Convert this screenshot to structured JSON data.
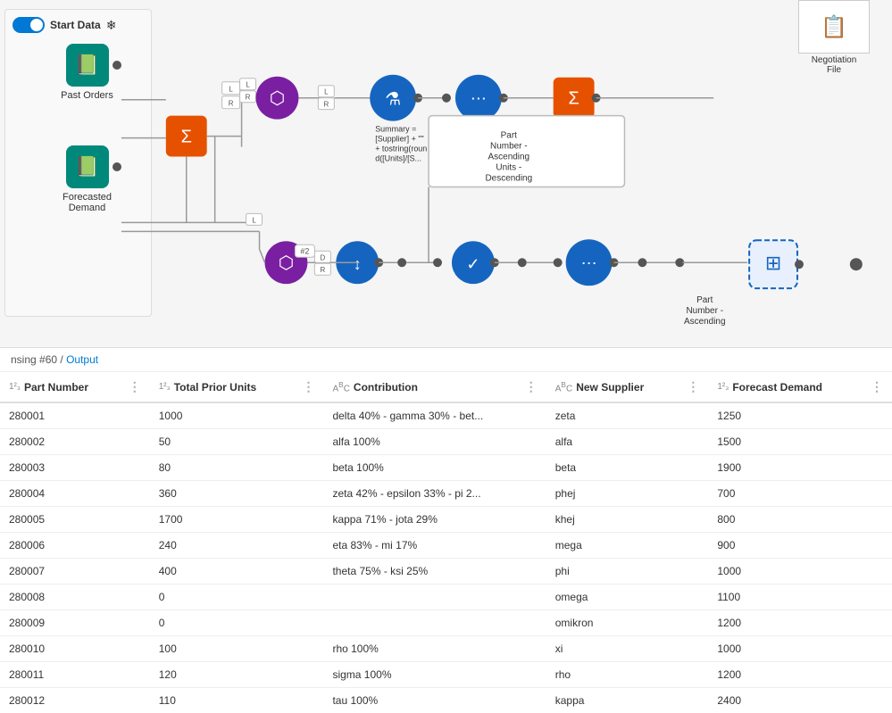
{
  "canvas": {
    "title": "Start Data",
    "snowflake_label": "❄",
    "nodes": {
      "past_orders": {
        "label": "Past Orders"
      },
      "forecasted_demand": {
        "label": "Forecasted\nDemand"
      },
      "summary_formula": {
        "label": "Summary =\n[Supplier] + \"\"\n+ tostring(roun\nd([Units]/[S..."
      },
      "part_number_sort": {
        "label": "Part\nNumber -\nAscending\nUnits -\nDescending"
      },
      "part_number_asc": {
        "label": "Part\nNumber -\nAscending"
      },
      "neg_file": {
        "label": "Negotiation\nFile"
      }
    }
  },
  "breadcrumb": {
    "prefix": "nsing #60",
    "separator": " / ",
    "link": "Output"
  },
  "table": {
    "columns": [
      {
        "type": "123",
        "name": "Part Number",
        "id": "part_number"
      },
      {
        "type": "123",
        "name": "Total Prior Units",
        "id": "total_prior_units"
      },
      {
        "type": "ABC",
        "name": "Contribution",
        "id": "contribution"
      },
      {
        "type": "ABC",
        "name": "New Supplier",
        "id": "new_supplier"
      },
      {
        "type": "123",
        "name": "Forecast Demand",
        "id": "forecast_demand"
      }
    ],
    "rows": [
      {
        "part_number": "280001",
        "total_prior_units": "1000",
        "contribution": "delta 40% - gamma 30% - bet...",
        "new_supplier": "zeta",
        "forecast_demand": "1250"
      },
      {
        "part_number": "280002",
        "total_prior_units": "50",
        "contribution": "alfa 100%",
        "new_supplier": "alfa",
        "forecast_demand": "1500"
      },
      {
        "part_number": "280003",
        "total_prior_units": "80",
        "contribution": "beta 100%",
        "new_supplier": "beta",
        "forecast_demand": "1900"
      },
      {
        "part_number": "280004",
        "total_prior_units": "360",
        "contribution": "zeta 42% - epsilon 33% - pi 2...",
        "new_supplier": "phej",
        "forecast_demand": "700"
      },
      {
        "part_number": "280005",
        "total_prior_units": "1700",
        "contribution": "kappa 71% - jota 29%",
        "new_supplier": "khej",
        "forecast_demand": "800"
      },
      {
        "part_number": "280006",
        "total_prior_units": "240",
        "contribution": "eta 83% - mi 17%",
        "new_supplier": "mega",
        "forecast_demand": "900"
      },
      {
        "part_number": "280007",
        "total_prior_units": "400",
        "contribution": "theta 75% - ksi 25%",
        "new_supplier": "phi",
        "forecast_demand": "1000"
      },
      {
        "part_number": "280008",
        "total_prior_units": "0",
        "contribution": "",
        "new_supplier": "omega",
        "forecast_demand": "1100"
      },
      {
        "part_number": "280009",
        "total_prior_units": "0",
        "contribution": "",
        "new_supplier": "omikron",
        "forecast_demand": "1200"
      },
      {
        "part_number": "280010",
        "total_prior_units": "100",
        "contribution": "rho 100%",
        "new_supplier": "xi",
        "forecast_demand": "1000"
      },
      {
        "part_number": "280011",
        "total_prior_units": "120",
        "contribution": "sigma 100%",
        "new_supplier": "rho",
        "forecast_demand": "1200"
      },
      {
        "part_number": "280012",
        "total_prior_units": "110",
        "contribution": "tau 100%",
        "new_supplier": "kappa",
        "forecast_demand": "2400"
      }
    ]
  }
}
